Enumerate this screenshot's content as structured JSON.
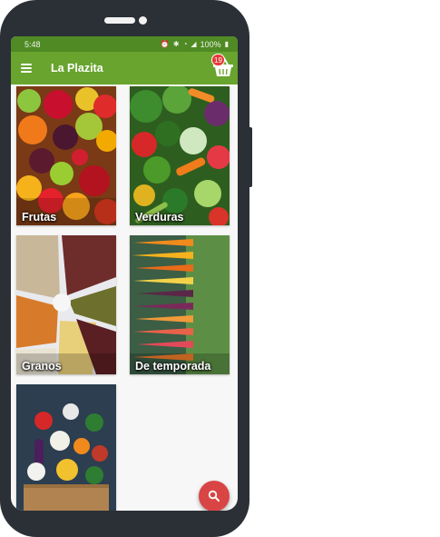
{
  "status_bar": {
    "time": "5:48",
    "battery": "100%"
  },
  "app_bar": {
    "title": "La Plazita",
    "cart_count": "19"
  },
  "categories": [
    {
      "label": "Frutas"
    },
    {
      "label": "Verduras"
    },
    {
      "label": "Granos"
    },
    {
      "label": "De temporada"
    },
    {
      "label": ""
    }
  ],
  "colors": {
    "app_bar": "#68a42e",
    "status_bar": "#4f8a24",
    "fab": "#d94545",
    "badge": "#e53935",
    "phone_frame": "#2b3036"
  },
  "icons": {
    "menu": "hamburger-menu-icon",
    "cart": "shopping-basket-icon",
    "fab": "search-icon"
  }
}
